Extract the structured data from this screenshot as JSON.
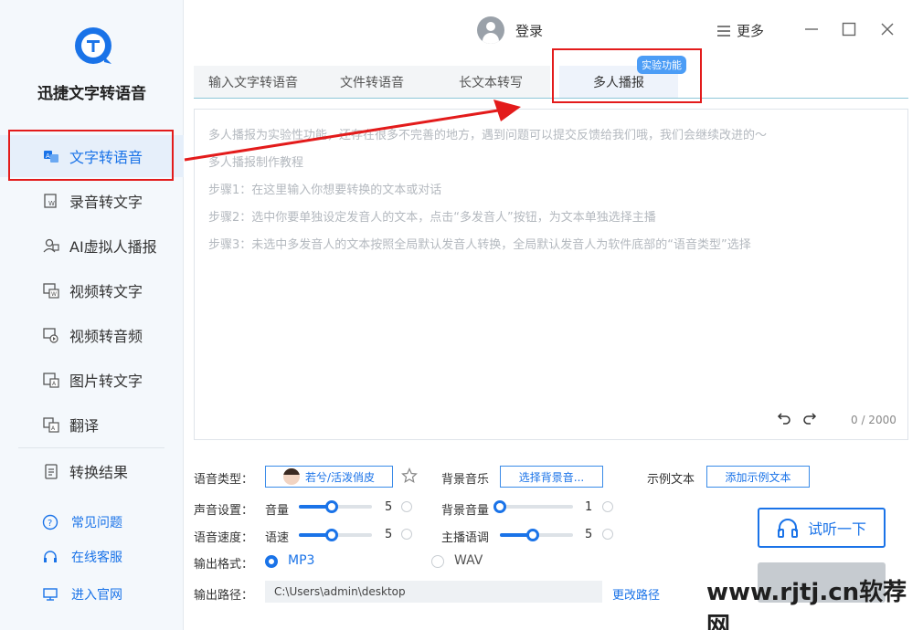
{
  "app": {
    "title": "迅捷文字转语音"
  },
  "sidebar": {
    "items": [
      {
        "label": "文字转语音",
        "icon": "text-to-speech-icon"
      },
      {
        "label": "录音转文字",
        "icon": "recording-to-text-icon"
      },
      {
        "label": "AI虚拟人播报",
        "icon": "ai-avatar-icon"
      },
      {
        "label": "视频转文字",
        "icon": "video-to-text-icon"
      },
      {
        "label": "视频转音频",
        "icon": "video-to-audio-icon"
      },
      {
        "label": "图片转文字",
        "icon": "image-to-text-icon"
      },
      {
        "label": "翻译",
        "icon": "translate-icon"
      },
      {
        "label": "转换结果",
        "icon": "results-icon"
      }
    ],
    "links": [
      {
        "label": "常见问题",
        "icon": "question-icon"
      },
      {
        "label": "在线客服",
        "icon": "headset-icon"
      },
      {
        "label": "进入官网",
        "icon": "monitor-icon"
      }
    ]
  },
  "header": {
    "login": "登录",
    "more": "更多"
  },
  "tabs": [
    "输入文字转语音",
    "文件转语音",
    "长文本转写",
    "多人播报"
  ],
  "badge": "实验功能",
  "editor": {
    "lines": [
      "多人播报为实验性功能，还存在很多不完善的地方，遇到问题可以提交反馈给我们哦，我们会继续改进的～",
      "多人播报制作教程",
      "步骤1：在这里输入你想要转换的文本或对话",
      "步骤2：选中你要单独设定发音人的文本，点击“多发音人”按钮，为文本单独选择主播",
      "步骤3：未选中多发音人的文本按照全局默认发音人转换，全局默认发音人为软件底部的“语音类型”选择"
    ],
    "counter": "0 / 2000"
  },
  "settings": {
    "voice_type_label": "语音类型：",
    "voice_name": "若兮/活泼俏皮",
    "bg_music_label": "背景音乐",
    "bg_music_button": "选择背景音...",
    "sample_text_label": "示例文本",
    "sample_text_button": "添加示例文本",
    "sound_label": "声音设置：",
    "volume_label": "音量",
    "volume_value": "5",
    "volume_level": 0.45,
    "bg_volume_label": "背景音量",
    "bg_volume_value": "1",
    "bg_volume_level": 0.0,
    "speed_row_label": "语音速度：",
    "speed_label": "语速",
    "speed_value": "5",
    "speed_level": 0.45,
    "intonation_label": "主播语调",
    "intonation_value": "5",
    "intonation_level": 0.45,
    "format_label": "输出格式：",
    "format_mp3": "MP3",
    "format_wav": "WAV",
    "path_label": "输出路径：",
    "path_value": "C:\\Users\\admin\\desktop",
    "change_path": "更改路径",
    "listen_button": "试听一下"
  },
  "watermark": "www.rjtj.cn软荐网",
  "colors": {
    "accent": "#1a73e8",
    "highlight": "#e31b1b"
  }
}
